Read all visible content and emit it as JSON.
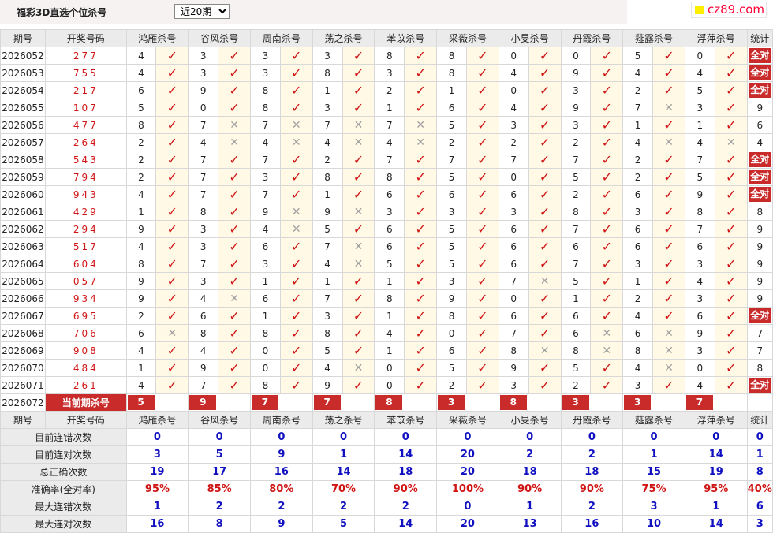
{
  "title": "福彩3D直选个位杀号",
  "period_select": {
    "value": "近20期",
    "options": [
      "近20期"
    ]
  },
  "logo": "cz89.com",
  "headers": {
    "period": "期号",
    "number": "开奖号码",
    "stat": "统计"
  },
  "experts": [
    "鸿雁杀号",
    "谷风杀号",
    "周南杀号",
    "荡之杀号",
    "苯苡杀号",
    "采薇杀号",
    "小旻杀号",
    "丹霞杀号",
    "薤露杀号",
    "浮萍杀号"
  ],
  "all_correct_label": "全对",
  "rows": [
    {
      "period": "2026052",
      "number": "277",
      "kills": [
        "4",
        "3",
        "3",
        "3",
        "8",
        "8",
        "0",
        "0",
        "5",
        "0"
      ],
      "marks": [
        1,
        1,
        1,
        1,
        1,
        1,
        1,
        1,
        1,
        1
      ],
      "stat": "全对"
    },
    {
      "period": "2026053",
      "number": "755",
      "kills": [
        "4",
        "3",
        "3",
        "8",
        "3",
        "8",
        "4",
        "9",
        "4",
        "4"
      ],
      "marks": [
        1,
        1,
        1,
        1,
        1,
        1,
        1,
        1,
        1,
        1
      ],
      "stat": "全对"
    },
    {
      "period": "2026054",
      "number": "217",
      "kills": [
        "6",
        "9",
        "8",
        "1",
        "2",
        "1",
        "0",
        "3",
        "2",
        "5"
      ],
      "marks": [
        1,
        1,
        1,
        1,
        1,
        1,
        1,
        1,
        1,
        1
      ],
      "stat": "全对"
    },
    {
      "period": "2026055",
      "number": "107",
      "kills": [
        "5",
        "0",
        "8",
        "3",
        "1",
        "6",
        "4",
        "9",
        "7",
        "3"
      ],
      "marks": [
        1,
        1,
        1,
        1,
        1,
        1,
        1,
        1,
        0,
        1
      ],
      "stat": "9"
    },
    {
      "period": "2026056",
      "number": "477",
      "kills": [
        "8",
        "7",
        "7",
        "7",
        "7",
        "5",
        "3",
        "3",
        "1",
        "1"
      ],
      "marks": [
        1,
        0,
        0,
        0,
        0,
        1,
        1,
        1,
        1,
        1
      ],
      "stat": "6"
    },
    {
      "period": "2026057",
      "number": "264",
      "kills": [
        "2",
        "4",
        "4",
        "4",
        "4",
        "2",
        "2",
        "2",
        "4",
        "4"
      ],
      "marks": [
        1,
        0,
        0,
        0,
        0,
        1,
        1,
        1,
        0,
        0
      ],
      "stat": "4"
    },
    {
      "period": "2026058",
      "number": "543",
      "kills": [
        "2",
        "7",
        "7",
        "2",
        "7",
        "7",
        "7",
        "7",
        "2",
        "7"
      ],
      "marks": [
        1,
        1,
        1,
        1,
        1,
        1,
        1,
        1,
        1,
        1
      ],
      "stat": "全对"
    },
    {
      "period": "2026059",
      "number": "794",
      "kills": [
        "2",
        "7",
        "3",
        "8",
        "8",
        "5",
        "0",
        "5",
        "2",
        "5"
      ],
      "marks": [
        1,
        1,
        1,
        1,
        1,
        1,
        1,
        1,
        1,
        1
      ],
      "stat": "全对"
    },
    {
      "period": "2026060",
      "number": "943",
      "kills": [
        "4",
        "7",
        "7",
        "1",
        "6",
        "6",
        "6",
        "2",
        "6",
        "9"
      ],
      "marks": [
        1,
        1,
        1,
        1,
        1,
        1,
        1,
        1,
        1,
        1
      ],
      "stat": "全对"
    },
    {
      "period": "2026061",
      "number": "429",
      "kills": [
        "1",
        "8",
        "9",
        "9",
        "3",
        "3",
        "3",
        "8",
        "3",
        "8"
      ],
      "marks": [
        1,
        1,
        0,
        0,
        1,
        1,
        1,
        1,
        1,
        1
      ],
      "stat": "8"
    },
    {
      "period": "2026062",
      "number": "294",
      "kills": [
        "9",
        "3",
        "4",
        "5",
        "6",
        "5",
        "6",
        "7",
        "6",
        "7"
      ],
      "marks": [
        1,
        1,
        0,
        1,
        1,
        1,
        1,
        1,
        1,
        1
      ],
      "stat": "9"
    },
    {
      "period": "2026063",
      "number": "517",
      "kills": [
        "4",
        "3",
        "6",
        "7",
        "6",
        "5",
        "6",
        "6",
        "6",
        "6"
      ],
      "marks": [
        1,
        1,
        1,
        0,
        1,
        1,
        1,
        1,
        1,
        1
      ],
      "stat": "9"
    },
    {
      "period": "2026064",
      "number": "604",
      "kills": [
        "8",
        "7",
        "3",
        "4",
        "5",
        "5",
        "6",
        "7",
        "3",
        "3"
      ],
      "marks": [
        1,
        1,
        1,
        0,
        1,
        1,
        1,
        1,
        1,
        1
      ],
      "stat": "9"
    },
    {
      "period": "2026065",
      "number": "057",
      "kills": [
        "9",
        "3",
        "1",
        "1",
        "1",
        "3",
        "7",
        "5",
        "1",
        "4"
      ],
      "marks": [
        1,
        1,
        1,
        1,
        1,
        1,
        0,
        1,
        1,
        1
      ],
      "stat": "9"
    },
    {
      "period": "2026066",
      "number": "934",
      "kills": [
        "9",
        "4",
        "6",
        "7",
        "8",
        "9",
        "0",
        "1",
        "2",
        "3"
      ],
      "marks": [
        1,
        0,
        1,
        1,
        1,
        1,
        1,
        1,
        1,
        1
      ],
      "stat": "9"
    },
    {
      "period": "2026067",
      "number": "695",
      "kills": [
        "2",
        "6",
        "1",
        "3",
        "1",
        "8",
        "6",
        "6",
        "4",
        "6"
      ],
      "marks": [
        1,
        1,
        1,
        1,
        1,
        1,
        1,
        1,
        1,
        1
      ],
      "stat": "全对"
    },
    {
      "period": "2026068",
      "number": "706",
      "kills": [
        "6",
        "8",
        "8",
        "8",
        "4",
        "0",
        "7",
        "6",
        "6",
        "9"
      ],
      "marks": [
        0,
        1,
        1,
        1,
        1,
        1,
        1,
        0,
        0,
        1
      ],
      "stat": "7"
    },
    {
      "period": "2026069",
      "number": "908",
      "kills": [
        "4",
        "4",
        "0",
        "5",
        "1",
        "6",
        "8",
        "8",
        "8",
        "3"
      ],
      "marks": [
        1,
        1,
        1,
        1,
        1,
        1,
        0,
        0,
        0,
        1
      ],
      "stat": "7"
    },
    {
      "period": "2026070",
      "number": "484",
      "kills": [
        "1",
        "9",
        "0",
        "4",
        "0",
        "5",
        "9",
        "5",
        "4",
        "0"
      ],
      "marks": [
        1,
        1,
        1,
        0,
        1,
        1,
        1,
        1,
        0,
        1
      ],
      "stat": "8"
    },
    {
      "period": "2026071",
      "number": "261",
      "kills": [
        "4",
        "7",
        "8",
        "9",
        "0",
        "2",
        "3",
        "2",
        "3",
        "4"
      ],
      "marks": [
        1,
        1,
        1,
        1,
        1,
        1,
        1,
        1,
        1,
        1
      ],
      "stat": "全对"
    }
  ],
  "current": {
    "period": "2026072",
    "label": "当前期杀号",
    "kills": [
      "5",
      "9",
      "7",
      "7",
      "8",
      "3",
      "8",
      "3",
      "3",
      "7"
    ]
  },
  "stats": [
    {
      "label": "目前连错次数",
      "values": [
        "0",
        "0",
        "0",
        "0",
        "0",
        "0",
        "0",
        "0",
        "0",
        "0"
      ],
      "total": "0",
      "color": "blue"
    },
    {
      "label": "目前连对次数",
      "values": [
        "3",
        "5",
        "9",
        "1",
        "14",
        "20",
        "2",
        "2",
        "1",
        "14"
      ],
      "total": "1",
      "color": "blue"
    },
    {
      "label": "总正确次数",
      "values": [
        "19",
        "17",
        "16",
        "14",
        "18",
        "20",
        "18",
        "18",
        "15",
        "19"
      ],
      "total": "8",
      "color": "blue"
    },
    {
      "label": "准确率(全对率)",
      "values": [
        "95%",
        "85%",
        "80%",
        "70%",
        "90%",
        "100%",
        "90%",
        "90%",
        "75%",
        "95%"
      ],
      "total": "40%",
      "color": "red"
    },
    {
      "label": "最大连错次数",
      "values": [
        "1",
        "2",
        "2",
        "2",
        "2",
        "0",
        "1",
        "2",
        "3",
        "1"
      ],
      "total": "6",
      "color": "blue"
    },
    {
      "label": "最大连对次数",
      "values": [
        "16",
        "8",
        "9",
        "5",
        "14",
        "20",
        "13",
        "16",
        "10",
        "14"
      ],
      "total": "3",
      "color": "blue"
    }
  ],
  "colors": {
    "accent_red": "#c92b2b",
    "number_red": "#d01515",
    "stat_blue": "#1010c0",
    "mark_bg": "#fff9e6",
    "header_bg": "#ebebeb"
  }
}
